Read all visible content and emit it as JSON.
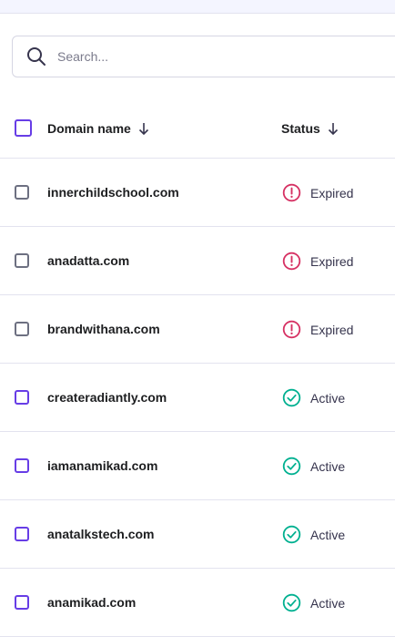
{
  "search": {
    "placeholder": "Search..."
  },
  "table": {
    "headers": {
      "domain": "Domain name",
      "status": "Status"
    },
    "rows": [
      {
        "domain": "innerchildschool.com",
        "status": "Expired",
        "status_type": "expired"
      },
      {
        "domain": "anadatta.com",
        "status": "Expired",
        "status_type": "expired"
      },
      {
        "domain": "brandwithana.com",
        "status": "Expired",
        "status_type": "expired"
      },
      {
        "domain": "createradiantly.com",
        "status": "Active",
        "status_type": "active"
      },
      {
        "domain": "iamanamikad.com",
        "status": "Active",
        "status_type": "active"
      },
      {
        "domain": "anatalkstech.com",
        "status": "Active",
        "status_type": "active"
      },
      {
        "domain": "anamikad.com",
        "status": "Active",
        "status_type": "active"
      }
    ]
  },
  "colors": {
    "expired": "#d63163",
    "active": "#00b090",
    "accent": "#673de6",
    "checkbox_gray": "#6d7081"
  },
  "icons": {
    "search": "search-icon",
    "sort": "arrow-down-icon",
    "expired": "alert-circle-icon",
    "active": "check-circle-icon"
  }
}
